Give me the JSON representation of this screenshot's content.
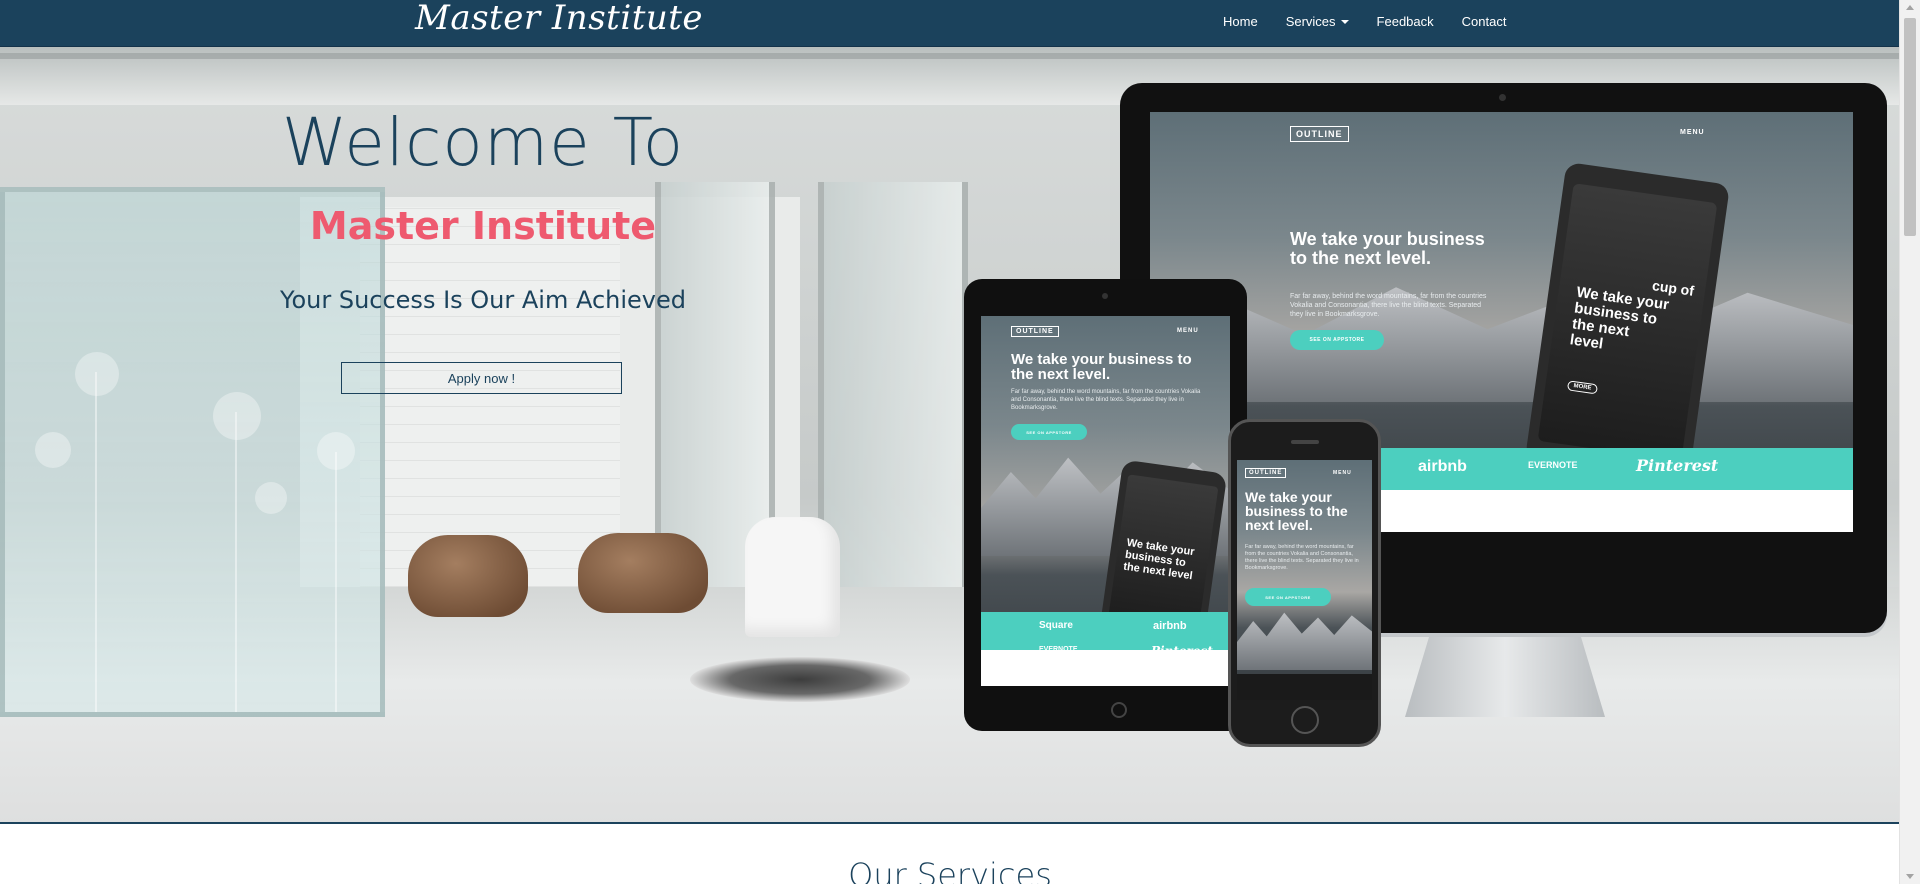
{
  "navbar": {
    "brand": "Master Institute",
    "links": [
      {
        "label": "Home"
      },
      {
        "label": "Services"
      },
      {
        "label": "Feedback"
      },
      {
        "label": "Contact"
      }
    ]
  },
  "hero": {
    "welcome": "Welcome To",
    "institute": "Master Institute",
    "tagline": "Your Success Is Our Aim Achieved",
    "apply_button": "Apply now !",
    "devices": {
      "logo": "OUTLINE",
      "menu": "MENU",
      "monitor_headline": "We take your business to the next level.",
      "tablet_headline": "We take your business to the next level.",
      "phone_headline": "We take your business to the next level.",
      "monitor_body": "Far far away, behind the word mountains, far from the countries Vokalia and Consonantia, there live the blind texts. Separated they live in Bookmarksgrove.",
      "tablet_body": "Far far away, behind the word mountains, far from the countries Vokalia and Consonantia, there live the blind texts. Separated they live in Bookmarksgrove.",
      "phone_body": "Far far away, behind the word mountains, far from the countries Vokalia and Consonantia, there live the blind texts. Separated they live in Bookmarksgrove.",
      "store_button": "SEE ON APPSTORE",
      "phone_overlay": "We take your business to the next level",
      "phone_overlay_2": "cup of",
      "phone_overlay_btn": "MORE",
      "partners": [
        "airbnb",
        "EVERNOTE",
        "Pinterest",
        "Square"
      ]
    }
  },
  "services": {
    "title": "Our Services"
  },
  "colors": {
    "navbar": "#1b425c",
    "accent_pink": "#ee5a6f",
    "teal": "#4ccfbf"
  }
}
